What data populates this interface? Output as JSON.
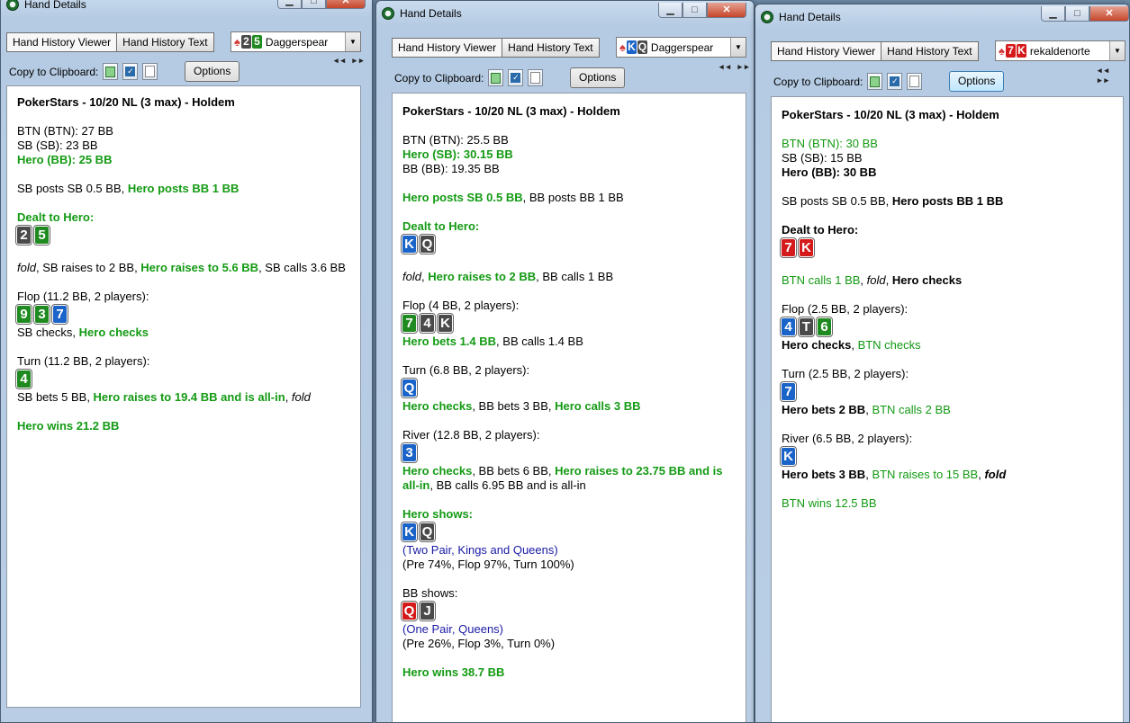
{
  "colors": {
    "club": "#1f8a1f",
    "heart": "#d41a1a",
    "diamond": "#1a63c9",
    "spade": "#4a4a4a",
    "hero": "#139a13"
  },
  "common": {
    "tab_viewer": "Hand History Viewer",
    "tab_text": "Hand History Text",
    "copy_label": "Copy to Clipboard:",
    "options": "Options",
    "title": "Hand Details",
    "arrows": "◂◂ ▸▸"
  },
  "w1": {
    "player": {
      "cards": [
        {
          "r": "2",
          "s": "spade"
        },
        {
          "r": "5",
          "s": "club"
        }
      ],
      "name": "Daggerspear"
    },
    "header": "PokerStars - 10/20 NL (3 max) - Holdem",
    "stacks": [
      "BTN (BTN): 27 BB",
      "SB (SB): 23 BB",
      "Hero (BB): 25 BB"
    ],
    "posts_a": "SB posts SB 0.5 BB, ",
    "posts_b": "Hero posts BB 1 BB",
    "dealt_label": "Dealt to Hero:",
    "dealt": [
      {
        "r": "2",
        "s": "spade"
      },
      {
        "r": "5",
        "s": "club"
      }
    ],
    "pre_a": "fold",
    "pre_b": ", SB raises to 2 BB, ",
    "pre_c": "Hero raises to 5.6 BB",
    "pre_d": ", SB calls 3.6 BB",
    "flop_label": "Flop (11.2 BB, 2 players):",
    "flop": [
      {
        "r": "9",
        "s": "club"
      },
      {
        "r": "3",
        "s": "club"
      },
      {
        "r": "7",
        "s": "diamond"
      }
    ],
    "flop_a": "SB checks, ",
    "flop_b": "Hero checks",
    "turn_label": "Turn (11.2 BB, 2 players):",
    "turn": [
      {
        "r": "4",
        "s": "club"
      }
    ],
    "turn_a": "SB bets 5 BB, ",
    "turn_b": "Hero raises to 19.4 BB and is all-in",
    "turn_c": ", ",
    "turn_d": "fold",
    "result": "Hero wins 21.2 BB"
  },
  "w2": {
    "player": {
      "cards": [
        {
          "r": "K",
          "s": "diamond"
        },
        {
          "r": "Q",
          "s": "spade"
        }
      ],
      "name": "Daggerspear"
    },
    "header": "PokerStars - 10/20 NL (3 max) - Holdem",
    "stacks": [
      "BTN (BTN): 25.5 BB",
      "Hero (SB): 30.15 BB",
      "BB (BB): 19.35 BB"
    ],
    "posts_a": "Hero posts SB 0.5 BB",
    "posts_b": ", BB posts BB 1 BB",
    "dealt_label": "Dealt to Hero:",
    "dealt": [
      {
        "r": "K",
        "s": "diamond"
      },
      {
        "r": "Q",
        "s": "spade"
      }
    ],
    "pre_a": "fold",
    "pre_b": ", ",
    "pre_c": "Hero raises to 2 BB",
    "pre_d": ", BB calls 1 BB",
    "flop_label": "Flop (4 BB, 2 players):",
    "flop": [
      {
        "r": "7",
        "s": "club"
      },
      {
        "r": "4",
        "s": "spade"
      },
      {
        "r": "K",
        "s": "spade"
      }
    ],
    "flop_a": "Hero bets 1.4 BB",
    "flop_b": ", BB calls 1.4 BB",
    "turn_label": "Turn (6.8 BB, 2 players):",
    "turn": [
      {
        "r": "Q",
        "s": "diamond"
      }
    ],
    "turn_a": "Hero checks",
    "turn_b": ", BB bets 3 BB, ",
    "turn_c": "Hero calls 3 BB",
    "river_label": "River (12.8 BB, 2 players):",
    "river": [
      {
        "r": "3",
        "s": "diamond"
      }
    ],
    "river_a": "Hero checks",
    "river_b": ", BB bets 6 BB, ",
    "river_c": "Hero raises to 23.75 BB and is",
    "river_d": "all-in",
    "river_e": ", BB calls 6.95 BB and is all-in",
    "hero_shows": "Hero shows:",
    "hero_cards": [
      {
        "r": "K",
        "s": "diamond"
      },
      {
        "r": "Q",
        "s": "spade"
      }
    ],
    "hero_hand": "(Two Pair, Kings and Queens)",
    "hero_eq": "(Pre 74%, Flop 97%, Turn 100%)",
    "bb_shows": "BB shows:",
    "bb_cards": [
      {
        "r": "Q",
        "s": "heart"
      },
      {
        "r": "J",
        "s": "spade"
      }
    ],
    "bb_hand": "(One Pair, Queens)",
    "bb_eq": "(Pre 26%, Flop 3%, Turn 0%)",
    "result": "Hero wins 38.7 BB"
  },
  "w3": {
    "player": {
      "cards": [
        {
          "r": "7",
          "s": "heart"
        },
        {
          "r": "K",
          "s": "heart"
        }
      ],
      "name": "rekaldenorte"
    },
    "header": "PokerStars - 10/20 NL (3 max) - Holdem",
    "stacks": [
      "BTN (BTN): 30 BB",
      "SB (SB): 15 BB",
      "Hero (BB): 30 BB"
    ],
    "posts_a": "SB posts SB 0.5 BB, ",
    "posts_b": "Hero posts BB 1 BB",
    "dealt_label": "Dealt to Hero:",
    "dealt": [
      {
        "r": "7",
        "s": "heart"
      },
      {
        "r": "K",
        "s": "heart"
      }
    ],
    "pre_a": "BTN calls 1 BB",
    "pre_b": ", ",
    "pre_c": "fold",
    "pre_d": ", ",
    "pre_e": "Hero checks",
    "flop_label": "Flop (2.5 BB, 2 players):",
    "flop": [
      {
        "r": "4",
        "s": "diamond"
      },
      {
        "r": "T",
        "s": "spade"
      },
      {
        "r": "6",
        "s": "club"
      }
    ],
    "flop_a": "Hero checks",
    "flop_b": ", ",
    "flop_c": "BTN checks",
    "turn_label": "Turn (2.5 BB, 2 players):",
    "turn": [
      {
        "r": "7",
        "s": "diamond"
      }
    ],
    "turn_a": "Hero bets 2 BB",
    "turn_b": ", ",
    "turn_c": "BTN calls 2 BB",
    "river_label": "River (6.5 BB, 2 players):",
    "river": [
      {
        "r": "K",
        "s": "diamond"
      }
    ],
    "river_a": "Hero bets 3 BB",
    "river_b": ", ",
    "river_c": "BTN raises to 15 BB",
    "river_d": ", ",
    "river_e": "fold",
    "result": "BTN wins 12.5 BB"
  }
}
